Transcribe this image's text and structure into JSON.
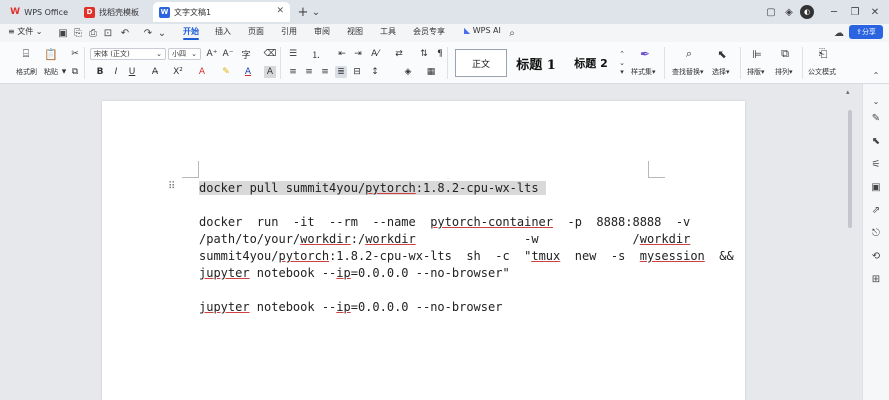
{
  "titlebar": {
    "tabs": [
      {
        "label": "WPS Office",
        "logo": "W",
        "logo_color": "#e0302a"
      },
      {
        "label": "找稻壳模板",
        "logo": "D",
        "logo_color": "#e0302a"
      },
      {
        "label": "文字文稿1",
        "logo": "W",
        "logo_color": "#2a64e0"
      }
    ],
    "new_tab": "+",
    "tab_menu": "⌄"
  },
  "menubar": {
    "file": "文件",
    "items": [
      "开始",
      "插入",
      "页面",
      "引用",
      "审阅",
      "视图",
      "工具",
      "会员专享"
    ],
    "ai": "WPS AI",
    "share": "分享"
  },
  "ribbon": {
    "format_painter": "格式刷",
    "paste": "粘贴",
    "font_name": "宋体 (正文)",
    "font_size": "小四",
    "styles": {
      "normal": "正文",
      "heading1": "标题 1",
      "heading2": "标题 2"
    },
    "style_set": "样式集",
    "find_replace": "查找替换",
    "select": "选择",
    "sort": "排版",
    "arrange": "排列",
    "doc_mode": "公文模式"
  },
  "document": {
    "lines": [
      {
        "segments": [
          {
            "t": "docker pull summit4you/",
            "c": "hl"
          },
          {
            "t": "pytorch",
            "c": "hl wavy"
          },
          {
            "t": ":1.8.2-cpu-wx-lts ",
            "c": "hl"
          }
        ]
      },
      {
        "segments": [
          {
            "t": "docker  run  -it  --rm  --name  ",
            "c": ""
          },
          {
            "t": "pytorch-container",
            "c": "wavy"
          },
          {
            "t": "  -p  8888:8888  -v",
            "c": ""
          }
        ]
      },
      {
        "segments": [
          {
            "t": "/path/to/your/",
            "c": ""
          },
          {
            "t": "workdir",
            "c": "wavy"
          },
          {
            "t": ":/",
            "c": ""
          },
          {
            "t": "workdir",
            "c": "wavy"
          },
          {
            "t": "               -w             /",
            "c": ""
          },
          {
            "t": "workdir",
            "c": "wavy"
          }
        ]
      },
      {
        "segments": [
          {
            "t": "summit4you/",
            "c": ""
          },
          {
            "t": "pytorch",
            "c": "wavy"
          },
          {
            "t": ":1.8.2-cpu-wx-lts  sh  -c  \"",
            "c": ""
          },
          {
            "t": "tmux",
            "c": "wavy"
          },
          {
            "t": "  new  -s  ",
            "c": ""
          },
          {
            "t": "mysession",
            "c": "wavy"
          },
          {
            "t": "  &&",
            "c": ""
          }
        ]
      },
      {
        "segments": [
          {
            "t": "jupyter",
            "c": "wavy"
          },
          {
            "t": " notebook --",
            "c": ""
          },
          {
            "t": "ip",
            "c": "wavy"
          },
          {
            "t": "=0.0.0.0 --no-browser\"",
            "c": ""
          }
        ]
      },
      {
        "segments": [
          {
            "t": "jupyter",
            "c": "wavy"
          },
          {
            "t": " notebook --",
            "c": ""
          },
          {
            "t": "ip",
            "c": "wavy"
          },
          {
            "t": "=0.0.0.0 --no-browser",
            "c": ""
          }
        ]
      }
    ],
    "drag_handle": "⠿"
  },
  "colors": {
    "accent": "#1f5fd6",
    "highlight": "#d9d9d9",
    "spell_underline": "#d04040"
  }
}
